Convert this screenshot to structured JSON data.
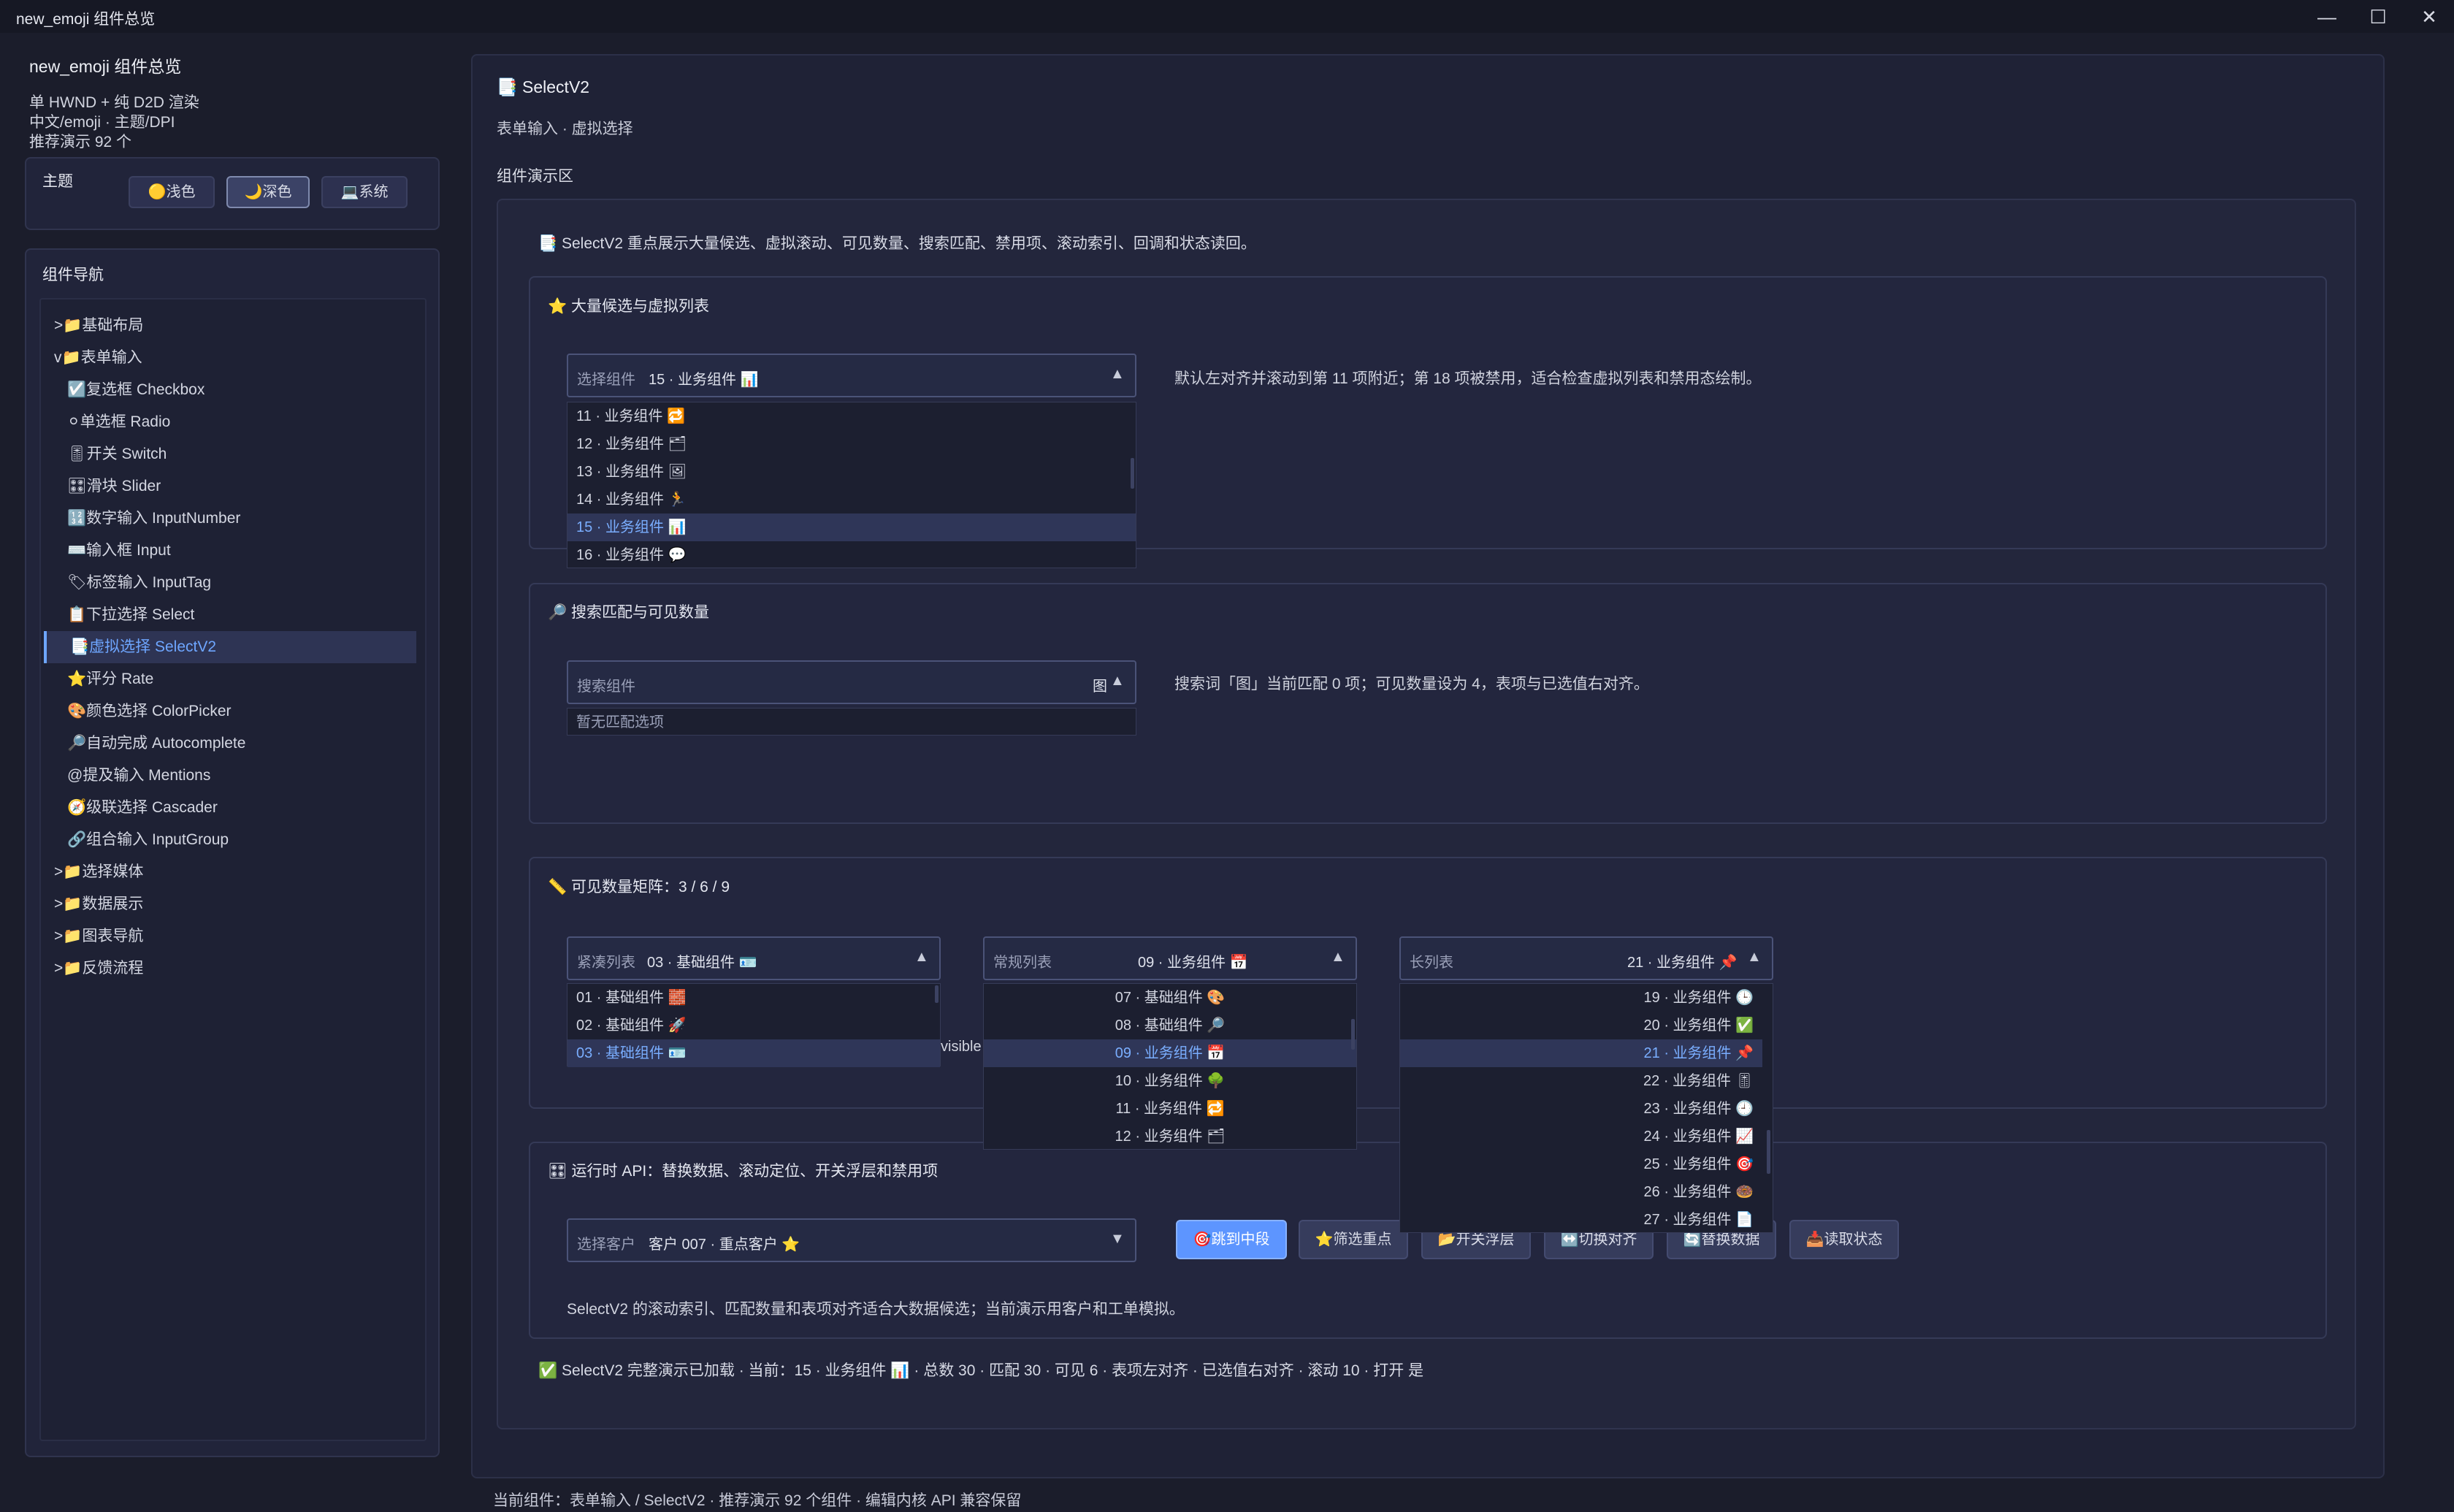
{
  "window": {
    "title": "new_emoji 组件总览",
    "minimize": "—",
    "maximize": "☐",
    "close": "✕"
  },
  "sidebar": {
    "app_name": "new_emoji 组件总览",
    "info_lines": [
      "单 HWND + 纯 D2D 渲染",
      "中文/emoji · 主题/DPI",
      "推荐演示 92 个"
    ],
    "theme": {
      "label": "主题",
      "buttons": [
        {
          "icon": "🟡",
          "label": "浅色"
        },
        {
          "icon": "🌙",
          "label": "深色"
        },
        {
          "icon": "💻",
          "label": "系统"
        }
      ]
    },
    "nav": {
      "header": "组件导航",
      "items": [
        {
          "text": ">📁基础布局"
        },
        {
          "text": "v📁表单输入"
        },
        {
          "text": "☑️复选框 Checkbox"
        },
        {
          "text": "⚪单选框 Radio"
        },
        {
          "text": "🎚开关 Switch"
        },
        {
          "text": "🎛滑块 Slider"
        },
        {
          "text": "🔢数字输入 InputNumber"
        },
        {
          "text": "⌨️输入框 Input"
        },
        {
          "text": "🏷标签输入 InputTag"
        },
        {
          "text": "📋下拉选择 Select"
        },
        {
          "text": "📑虚拟选择 SelectV2"
        },
        {
          "text": "⭐评分 Rate"
        },
        {
          "text": "🎨颜色选择 ColorPicker"
        },
        {
          "text": "🔎自动完成 Autocomplete"
        },
        {
          "text": "@提及输入 Mentions"
        },
        {
          "text": "🧭级联选择 Cascader"
        },
        {
          "text": "🔗组合输入 InputGroup"
        },
        {
          "text": ">📁选择媒体"
        },
        {
          "text": ">📁数据展示"
        },
        {
          "text": ">📁图表导航"
        },
        {
          "text": ">📁反馈流程"
        }
      ]
    }
  },
  "main": {
    "title": "📑 SelectV2",
    "subtitle": "表单输入 · 虚拟选择",
    "demo_label": "组件演示区",
    "intro": "📑 SelectV2 重点展示大量候选、虚拟滚动、可见数量、搜索匹配、禁用项、滚动索引、回调和状态读回。",
    "section1": {
      "title": "⭐ 大量候选与虚拟列表",
      "placeholder": "选择组件",
      "value": "15 · 业务组件 📊",
      "arrow": "▲",
      "note": "默认左对齐并滚动到第 11 项附近；第 18 项被禁用，适合检查虚拟列表和禁用态绘制。",
      "options": [
        "11 · 业务组件 🔁",
        "12 · 业务组件 🗂",
        "13 · 业务组件 🖼",
        "14 · 业务组件 🏃",
        "15 · 业务组件 📊",
        "16 · 业务组件 💬"
      ]
    },
    "section2": {
      "title": "🔎 搜索匹配与可见数量",
      "placeholder": "搜索组件",
      "query": "图",
      "arrow": "▲",
      "note": "搜索词「图」当前匹配 0 项；可见数量设为 4，表项与已选值右对齐。",
      "empty": "暂无匹配选项"
    },
    "section3": {
      "title": "📏 可见数量矩阵：3 / 6 / 9",
      "hidden_text": "visible",
      "compact": {
        "placeholder": "紧凑列表",
        "value": "03 · 基础组件 🪪",
        "arrow": "▲",
        "options": [
          "01 · 基础组件 🧱",
          "02 · 基础组件 🚀",
          "03 · 基础组件 🪪"
        ]
      },
      "normal": {
        "placeholder": "常规列表",
        "value": "09 · 业务组件 📅",
        "arrow": "▲",
        "options": [
          "07 · 基础组件 🎨",
          "08 · 基础组件 🔎",
          "09 · 业务组件 📅",
          "10 · 业务组件 🌳",
          "11 · 业务组件 🔁",
          "12 · 业务组件 🗂"
        ]
      },
      "long": {
        "placeholder": "长列表",
        "value": "21 · 业务组件 📌",
        "arrow": "▲",
        "options": [
          "19 · 业务组件 🕒",
          "20 · 业务组件 ✅",
          "21 · 业务组件 📌",
          "22 · 业务组件 🎚",
          "23 · 业务组件 🕘",
          "24 · 业务组件 📈",
          "25 · 业务组件 🎯",
          "26 · 业务组件 🍩",
          "27 · 业务组件 📄"
        ]
      }
    },
    "section4": {
      "title": "🎛 运行时 API：替换数据、滚动定位、开关浮层和禁用项",
      "placeholder": "选择客户",
      "value": "客户 007 · 重点客户 ⭐",
      "arrow": "▼",
      "buttons": [
        "🎯跳到中段",
        "⭐筛选重点",
        "📂开关浮层",
        "↔️切换对齐",
        "🔄替换数据",
        "📥读取状态"
      ],
      "note": "SelectV2 的滚动索引、匹配数量和表项对齐适合大数据候选；当前演示用客户和工单模拟。"
    },
    "status": "✅ SelectV2 完整演示已加载 · 当前：15 · 业务组件 📊 · 总数 30 · 匹配 30 · 可见 6 · 表项左对齐 · 已选值右对齐 · 滚动 10 · 打开 是"
  },
  "footer": "当前组件：表单输入 / SelectV2 · 推荐演示 92 个组件 · 编辑内核 API 兼容保留"
}
